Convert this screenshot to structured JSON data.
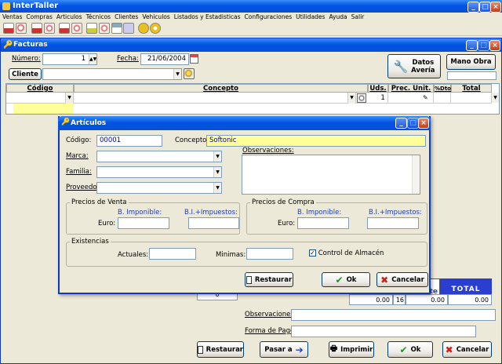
{
  "app": {
    "title": "InterTaller"
  },
  "menu": [
    "Ventas",
    "Compras",
    "Articulos",
    "Técnicos",
    "Clientes",
    "Vehiculos",
    "Listados y Estadisticas",
    "Configuraciones",
    "Utilidades",
    "Ayuda",
    "Salir"
  ],
  "facturas": {
    "title": "Facturas",
    "numero_label": "Número:",
    "numero_value": "1",
    "fecha_label": "Fecha:",
    "fecha_value": "21/06/2004",
    "cliente_button": "Cliente",
    "datos_averia_line1": "Datos",
    "datos_averia_line2": "Avería",
    "mano_obra_button": "Mano Obra",
    "columns": {
      "codigo": "Código",
      "concepto": "Concepto",
      "uds": "Uds.",
      "prec_unit": "Prec. Unit.",
      "dto": "%Dto",
      "total": "Total"
    },
    "row": {
      "uds": "1"
    },
    "totals_header": "TOTAL",
    "totals_header_partial": "te",
    "totals": {
      "a": "0.00",
      "b": "16",
      "c": "0.00",
      "d": "0.00"
    },
    "left_value": "0",
    "observaciones_label": "Observaciones:",
    "forma_pago_label": "Forma de Pago:",
    "buttons": {
      "restaurar": "Restaurar",
      "pasar": "Pasar a",
      "imprimir": "Imprimir",
      "ok": "Ok",
      "cancelar": "Cancelar"
    }
  },
  "articulos": {
    "title": "Artículos",
    "codigo_label": "Código:",
    "codigo_value": "00001",
    "concepto_label": "Concepto:",
    "concepto_value": "Softonic",
    "marca_label": "Marca:",
    "familia_label": "Familia:",
    "proveedor_label": "Proveedor:",
    "observaciones_label": "Observaciones:",
    "venta": {
      "legend": "Precios de Venta",
      "bi": "B. Imponible:",
      "bi_imp": "B.I.+Impuestos:",
      "euro": "Euro:"
    },
    "compra": {
      "legend": "Precios de Compra",
      "bi": "B. Imponible:",
      "bi_imp": "B.I.+Impuestos:",
      "euro": "Euro:"
    },
    "existencias": {
      "legend": "Existencias",
      "actuales": "Actuales:",
      "minimas": "Minimas:",
      "control": "Control de Almacén",
      "control_checked": true
    },
    "buttons": {
      "restaurar": "Restaurar",
      "ok": "Ok",
      "cancelar": "Cancelar"
    }
  },
  "colors": {
    "titlebar": "#0054e3",
    "yellow_field": "#ffff99",
    "totals_header": "#2a3fd0",
    "ok_icon": "#1a9a1a",
    "cancel_icon": "#d02010"
  }
}
